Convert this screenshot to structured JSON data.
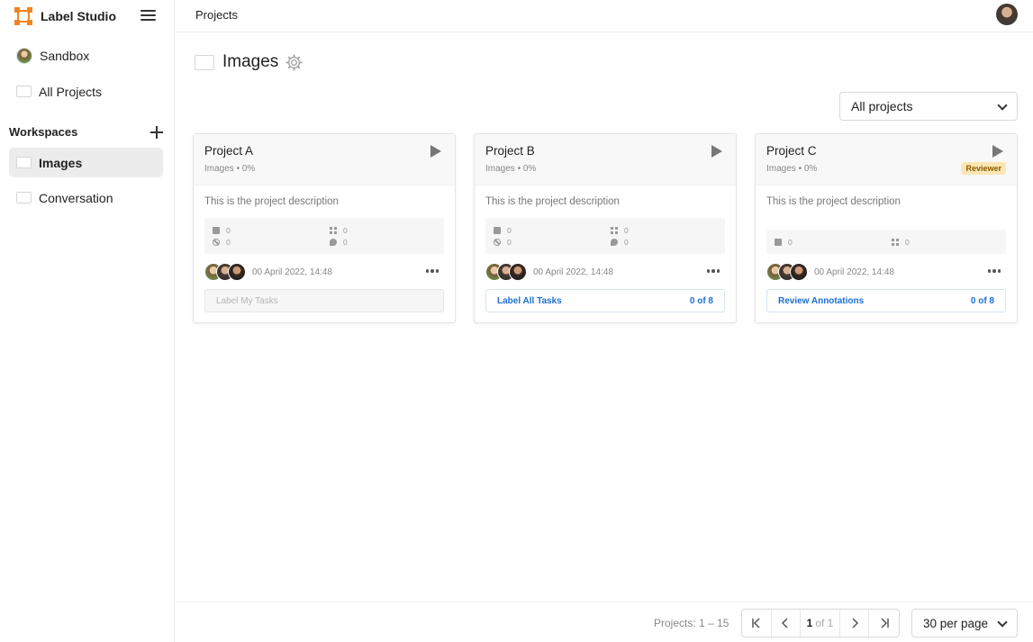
{
  "app": {
    "name": "Label Studio",
    "accent": "#f08522"
  },
  "sidebar": {
    "items": [
      {
        "label": "Sandbox"
      },
      {
        "label": "All Projects"
      }
    ],
    "workspaces_title": "Workspaces",
    "workspaces": [
      {
        "label": "Images",
        "active": true
      },
      {
        "label": "Conversation",
        "active": false
      }
    ]
  },
  "header": {
    "breadcrumb": "Projects"
  },
  "page": {
    "title": "Images",
    "filter": {
      "selected": "All projects"
    }
  },
  "projects": [
    {
      "title": "Project A",
      "subtitle": "Images • 0%",
      "badge": "",
      "description": "This is the project description",
      "stats": {
        "completed": "0",
        "regions": "0",
        "skipped": "0",
        "comments": "0"
      },
      "date": "00 April 2022, 14:48",
      "action": {
        "label": "Label My Tasks",
        "count": "",
        "state": "disabled"
      }
    },
    {
      "title": "Project B",
      "subtitle": "Images • 0%",
      "badge": "",
      "description": "This is the project description",
      "stats": {
        "completed": "0",
        "regions": "0",
        "skipped": "0",
        "comments": "0"
      },
      "date": "00 April 2022, 14:48",
      "action": {
        "label": "Label All Tasks",
        "count": "0 of 8",
        "state": "primary"
      }
    },
    {
      "title": "Project C",
      "subtitle": "Images • 0%",
      "badge": "Reviewer",
      "description": "This is the project description",
      "stats": {
        "completed": "0",
        "regions": "0"
      },
      "date": "00 April 2022, 14:48",
      "action": {
        "label": "Review Annotations",
        "count": "0 of 8",
        "state": "primary"
      }
    }
  ],
  "footer": {
    "count_text": "Projects: 1 – 15",
    "page_current": "1",
    "page_of": "of 1",
    "per_page": "30 per page"
  }
}
